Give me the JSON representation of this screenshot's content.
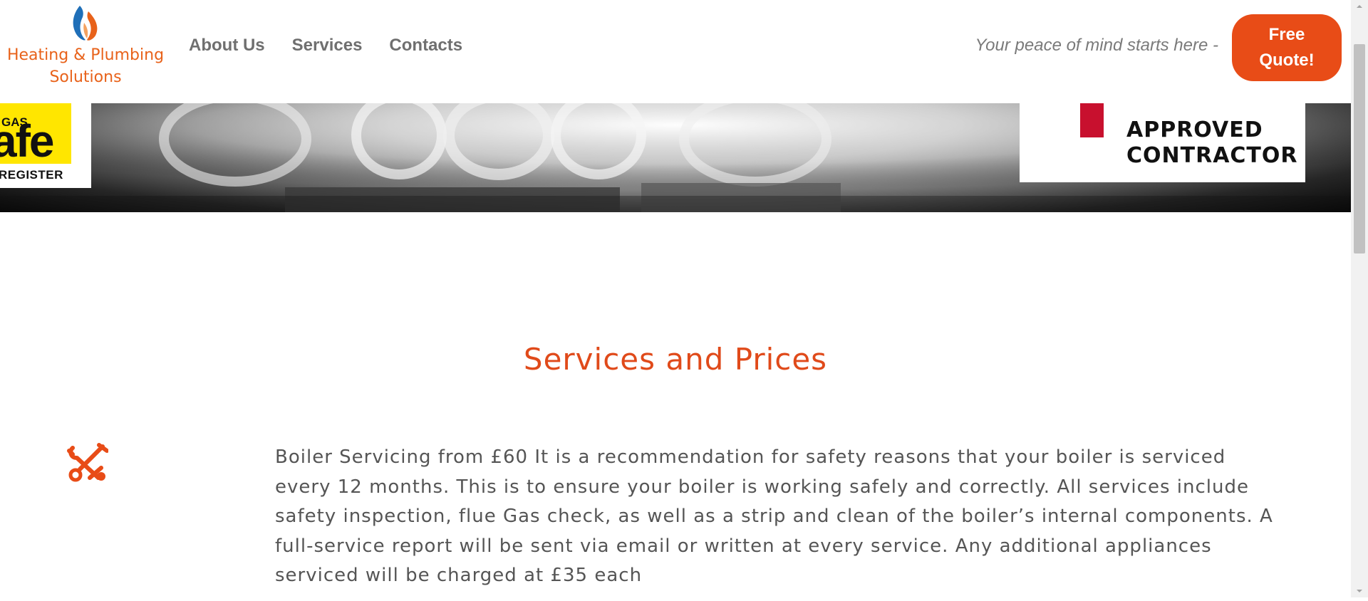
{
  "header": {
    "logo_text_line1": "Heating & Plumbing",
    "logo_text_line2": "Solutions",
    "nav": [
      {
        "label": "About Us"
      },
      {
        "label": "Services"
      },
      {
        "label": "Contacts"
      }
    ],
    "tagline": "Your peace of mind starts here -",
    "cta_line1": "Free",
    "cta_line2": "Quote!"
  },
  "banner": {
    "gassafe_small": "GAS",
    "gassafe_big": "afe",
    "gassafe_register": "REGISTER",
    "approved_line1": "APPROVED",
    "approved_line2": "CONTRACTOR"
  },
  "main": {
    "section_title": "Services and Prices",
    "services": [
      {
        "icon": "tools-icon",
        "text": "Boiler Servicing from £60 It is a recommendation for safety reasons that your boiler is serviced every 12 months. This is to ensure your boiler is working safely and correctly. All services include safety inspection, flue Gas check, as well as a strip and clean of the boiler’s internal components. A full-service report will be sent via email or written at every service. Any additional appliances serviced will be charged at £35 each"
      }
    ]
  },
  "colors": {
    "accent": "#e84c17",
    "heading": "#e04a1a",
    "logo_text": "#e8621a",
    "nav_text": "#6f6f6f",
    "body_text": "#555555"
  }
}
